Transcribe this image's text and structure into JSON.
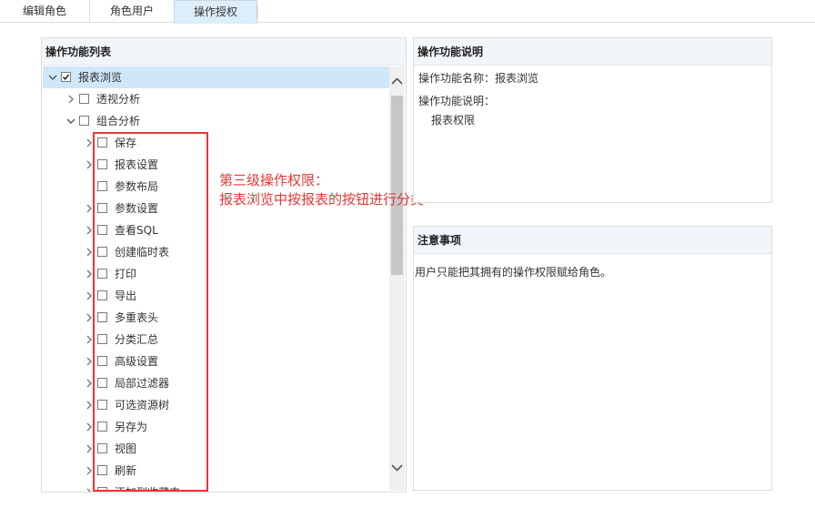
{
  "tabs": [
    {
      "label": "编辑角色",
      "active": false
    },
    {
      "label": "角色用户",
      "active": false
    },
    {
      "label": "操作授权",
      "active": true
    }
  ],
  "left_panel": {
    "title": "操作功能列表",
    "tree": [
      {
        "label": "报表浏览",
        "level": 0,
        "expanded": true,
        "checked": true,
        "selected": true
      },
      {
        "label": "透视分析",
        "level": 1,
        "expanded": false,
        "checked": false
      },
      {
        "label": "组合分析",
        "level": 1,
        "expanded": true,
        "checked": false
      },
      {
        "label": "保存",
        "level": 2,
        "expanded": false,
        "checked": false
      },
      {
        "label": "报表设置",
        "level": 2,
        "expanded": false,
        "checked": false
      },
      {
        "label": "参数布局",
        "level": 2,
        "leaf": true,
        "checked": false
      },
      {
        "label": "参数设置",
        "level": 2,
        "expanded": false,
        "checked": false
      },
      {
        "label": "查看SQL",
        "level": 2,
        "expanded": false,
        "checked": false
      },
      {
        "label": "创建临时表",
        "level": 2,
        "expanded": false,
        "checked": false
      },
      {
        "label": "打印",
        "level": 2,
        "expanded": false,
        "checked": false
      },
      {
        "label": "导出",
        "level": 2,
        "expanded": false,
        "checked": false
      },
      {
        "label": "多重表头",
        "level": 2,
        "expanded": false,
        "checked": false
      },
      {
        "label": "分类汇总",
        "level": 2,
        "expanded": false,
        "checked": false
      },
      {
        "label": "高级设置",
        "level": 2,
        "expanded": false,
        "checked": false
      },
      {
        "label": "局部过滤器",
        "level": 2,
        "expanded": false,
        "checked": false
      },
      {
        "label": "可选资源树",
        "level": 2,
        "expanded": false,
        "checked": false
      },
      {
        "label": "另存为",
        "level": 2,
        "expanded": false,
        "checked": false
      },
      {
        "label": "视图",
        "level": 2,
        "expanded": false,
        "checked": false
      },
      {
        "label": "刷新",
        "level": 2,
        "expanded": false,
        "checked": false
      },
      {
        "label": "添加到收藏夹",
        "level": 2,
        "expanded": false,
        "checked": false
      }
    ]
  },
  "annotation": {
    "line1": "第三级操作权限：",
    "line2": "报表浏览中按报表的按钮进行分类",
    "color": "#e53935"
  },
  "desc_panel": {
    "title": "操作功能说明",
    "name_line": "操作功能名称：报表浏览",
    "desc_label": "操作功能说明：",
    "desc_value": "报表权限"
  },
  "notes_panel": {
    "title": "注意事项",
    "text": "用户只能把其拥有的操作权限赋给角色。"
  },
  "colors": {
    "selected_row": "#cfe7f7",
    "active_tab": "#ddeefa",
    "panel_header": "#f2f6fa"
  }
}
